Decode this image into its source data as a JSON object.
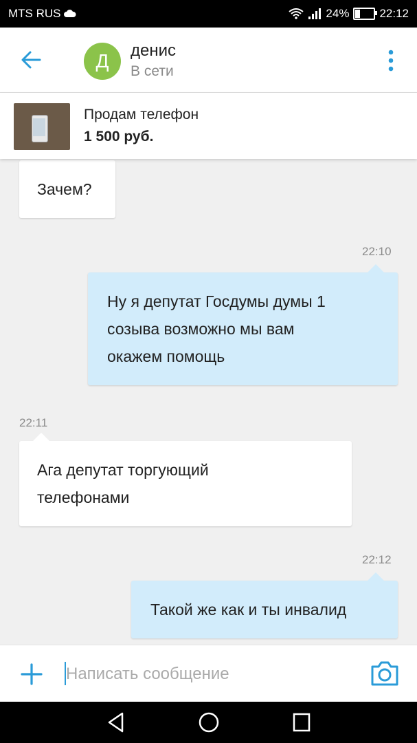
{
  "status_bar": {
    "carrier": "MTS RUS",
    "battery": "24%",
    "battery_level": 0.24,
    "time": "22:12"
  },
  "header": {
    "avatar_letter": "Д",
    "name": "денис",
    "status": "В сети"
  },
  "listing": {
    "title": "Продам телефон",
    "price": "1 500 руб."
  },
  "messages": [
    {
      "side": "in",
      "text": "Зачем?"
    },
    {
      "side": "out",
      "time": "22:10",
      "lines": [
        "Ну я депутат Госдумы думы 1",
        "созыва возможно мы вам",
        "окажем помощь"
      ]
    },
    {
      "side": "in",
      "time": "22:11",
      "lines": [
        "Ага депутат торгующий",
        "телефонами"
      ]
    },
    {
      "side": "out",
      "time": "22:12",
      "text": "Такой же как и ты инвалид"
    }
  ],
  "composer": {
    "placeholder": "Написать сообщение"
  },
  "colors": {
    "accent": "#2a9bd8",
    "avatar": "#8bc34a",
    "outgoing_bubble": "#d2ecfb",
    "incoming_bubble": "#ffffff",
    "background": "#f0f0f0"
  }
}
